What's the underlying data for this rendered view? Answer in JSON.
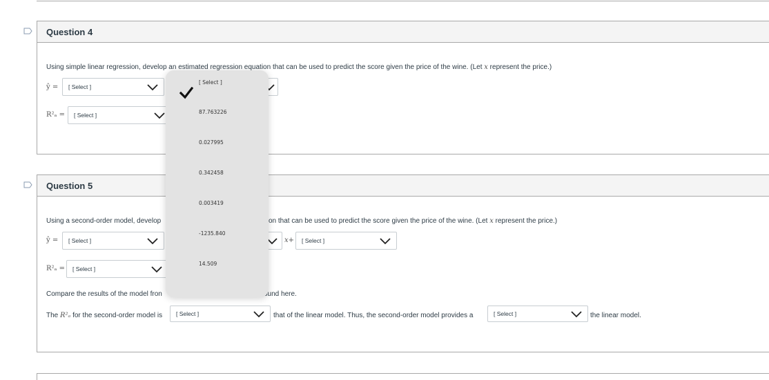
{
  "question4": {
    "title": "Question 4",
    "prompt_before": "Using simple linear regression, develop an estimated regression equation that can be used to predict the score given the price of the wine. (Let ",
    "prompt_var": "x",
    "prompt_after": " represent the price.)",
    "yhat_label": "ŷ =",
    "r2_label": "R²ₐ =",
    "yhat_select": "[ Select ]",
    "r2_select": "[ Select ]"
  },
  "question5": {
    "title": "Question 5",
    "prompt_visible_left": "Using a second-order model, develop",
    "prompt_visible_right": "on that can be used to predict the score given the price of the wine. (Let ",
    "prompt_var": "x",
    "prompt_after": " represent the price.)",
    "yhat_label": "ŷ =",
    "r2_label": "R²ₐ =",
    "yhat_select": "[ Select ]",
    "x_plus": "x+",
    "coef2_select": "[ Select ]",
    "r2_select": "[ Select ]",
    "compare_left": "Compare the results of the model fron",
    "compare_right": "ound here.",
    "the_label": "The",
    "r2_inline": "R²ₐ",
    "sentence_mid": "for the second-order model is",
    "compare_select": "[ Select ]",
    "sentence_after": "that of the linear model.  Thus, the second-order model provides a",
    "fit_select": "[ Select ]",
    "sentence_end": "the linear model."
  },
  "dropdown": {
    "selected": "[ Select ]",
    "options": [
      "[ Select ]",
      "87.763226",
      "0.027995",
      "0.342458",
      "0.003419",
      "-1235.840",
      "14.509"
    ]
  },
  "colors": {
    "border": "#a8a8a8",
    "header_bg": "#f4f4f4",
    "dropdown_bg": "#e3e3e3",
    "text": "#2d3b45"
  }
}
